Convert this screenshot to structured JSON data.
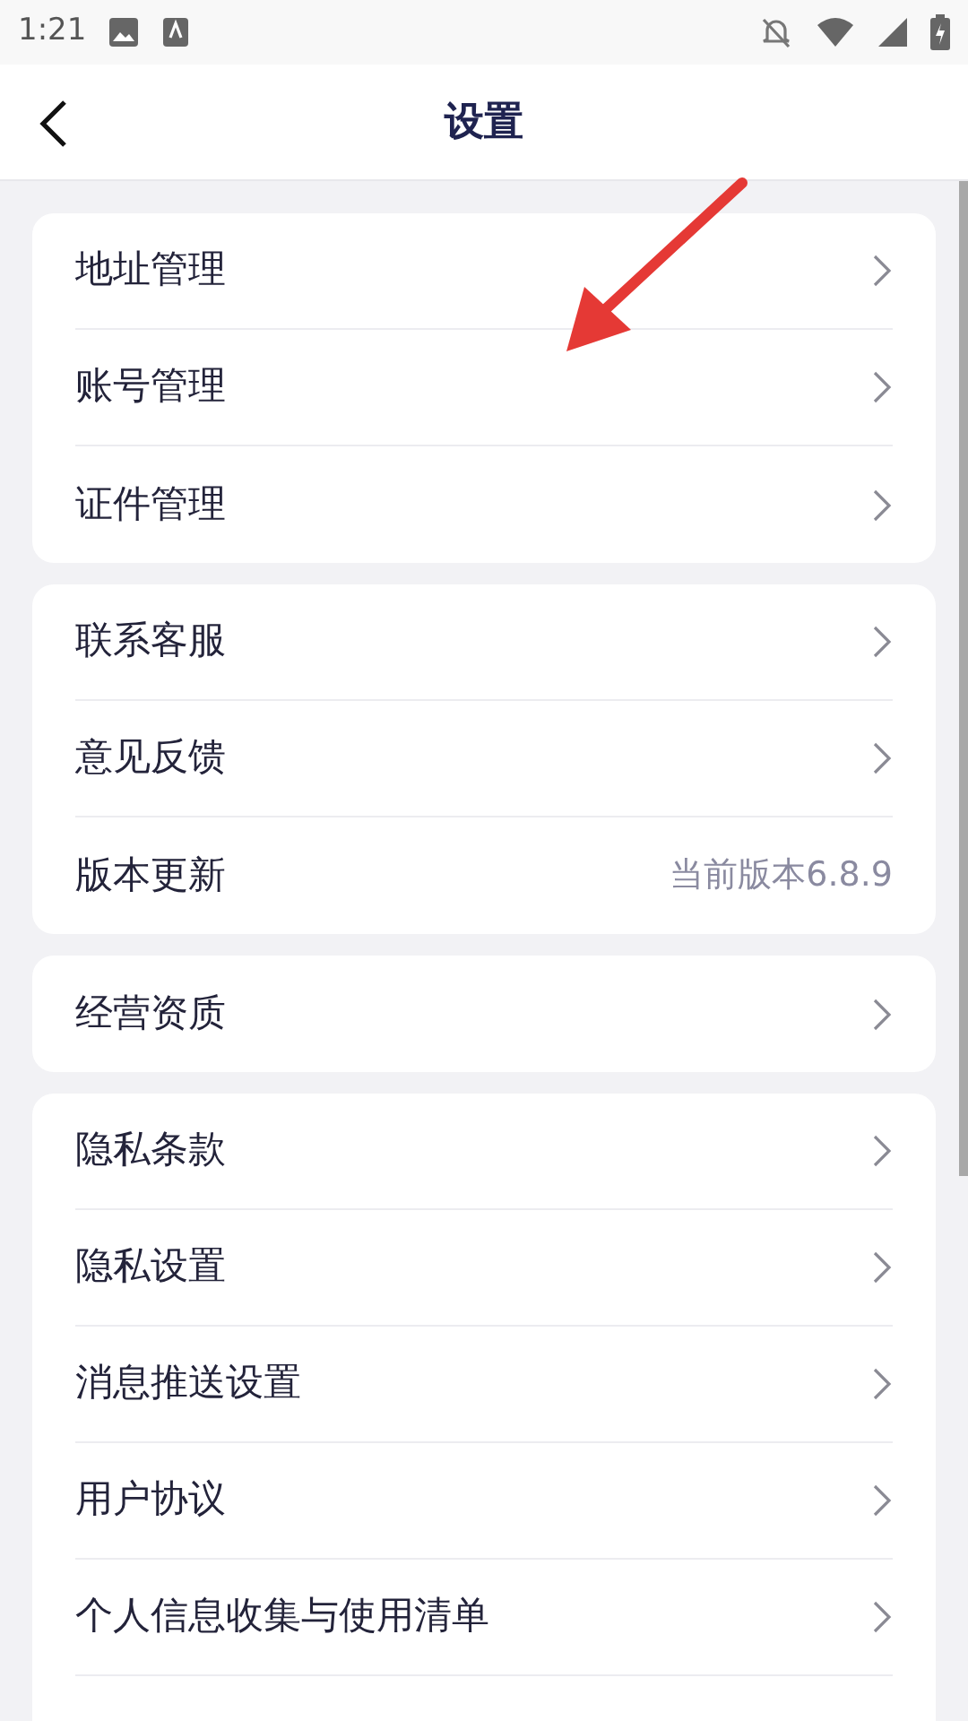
{
  "status_bar": {
    "time": "1:21"
  },
  "header": {
    "title": "设置"
  },
  "groups": [
    {
      "items": [
        {
          "kind": "link",
          "label": "地址管理"
        },
        {
          "kind": "link",
          "label": "账号管理"
        },
        {
          "kind": "link",
          "label": "证件管理"
        }
      ]
    },
    {
      "items": [
        {
          "kind": "link",
          "label": "联系客服"
        },
        {
          "kind": "link",
          "label": "意见反馈"
        },
        {
          "kind": "value",
          "label": "版本更新",
          "value": "当前版本6.8.9"
        }
      ]
    },
    {
      "items": [
        {
          "kind": "link",
          "label": "经营资质"
        }
      ]
    },
    {
      "items": [
        {
          "kind": "link",
          "label": "隐私条款"
        },
        {
          "kind": "link",
          "label": "隐私设置"
        },
        {
          "kind": "link",
          "label": "消息推送设置"
        },
        {
          "kind": "link",
          "label": "用户协议"
        },
        {
          "kind": "link",
          "label": "个人信息收集与使用清单"
        }
      ],
      "more_below": true
    }
  ]
}
